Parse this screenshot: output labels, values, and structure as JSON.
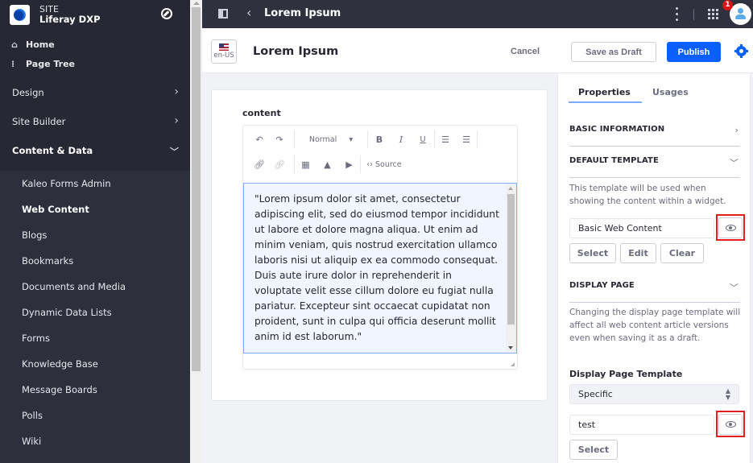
{
  "sidebar": {
    "site_label": "SITE",
    "site_name": "Liferay DXP",
    "home": "Home",
    "page_tree": "Page Tree",
    "sections": [
      {
        "label": "Design",
        "state": "collapsed"
      },
      {
        "label": "Site Builder",
        "state": "collapsed"
      },
      {
        "label": "Content & Data",
        "state": "expanded"
      }
    ],
    "content_items": [
      {
        "label": "Kaleo Forms Admin",
        "active": false
      },
      {
        "label": "Web Content",
        "active": true
      },
      {
        "label": "Blogs",
        "active": false
      },
      {
        "label": "Bookmarks",
        "active": false
      },
      {
        "label": "Documents and Media",
        "active": false
      },
      {
        "label": "Dynamic Data Lists",
        "active": false
      },
      {
        "label": "Forms",
        "active": false
      },
      {
        "label": "Knowledge Base",
        "active": false
      },
      {
        "label": "Message Boards",
        "active": false
      },
      {
        "label": "Polls",
        "active": false
      },
      {
        "label": "Wiki",
        "active": false
      }
    ]
  },
  "topbar": {
    "title": "Lorem Ipsum",
    "notification_count": "1"
  },
  "header": {
    "locale": "en-US",
    "title": "Lorem Ipsum",
    "cancel_label": "Cancel",
    "save_draft_label": "Save as Draft",
    "publish_label": "Publish"
  },
  "editor": {
    "field_label": "content",
    "format_select": "Normal",
    "source_label": "Source",
    "body": "\"Lorem ipsum dolor sit amet, consectetur adipiscing elit, sed do eiusmod tempor incididunt ut labore et dolore magna aliqua. Ut enim ad minim veniam, quis nostrud exercitation ullamco laboris nisi ut aliquip ex ea commodo consequat. Duis aute irure dolor in reprehenderit in voluptate velit esse cillum dolore eu fugiat nulla pariatur. Excepteur sint occaecat cupidatat non proident, sunt in culpa qui officia deserunt mollit anim id est laborum.\""
  },
  "panel": {
    "tabs": [
      {
        "label": "Properties",
        "active": true
      },
      {
        "label": "Usages",
        "active": false
      }
    ],
    "basic_information": "BASIC INFORMATION",
    "default_template": {
      "title": "DEFAULT TEMPLATE",
      "help": "This template will be used when showing the content within a widget.",
      "value": "Basic Web Content",
      "select_label": "Select",
      "edit_label": "Edit",
      "clear_label": "Clear"
    },
    "display_page": {
      "title": "DISPLAY PAGE",
      "help": "Changing the display page template will affect all web content article versions even when saving it as a draft.",
      "template_label": "Display Page Template",
      "template_option": "Specific",
      "value": "test",
      "select_label": "Select"
    }
  },
  "colors": {
    "primary": "#0b5fff",
    "sidebar_bg": "#2e2f3d",
    "highlight_outline": "#e01f1f",
    "badge": "#da1414"
  }
}
